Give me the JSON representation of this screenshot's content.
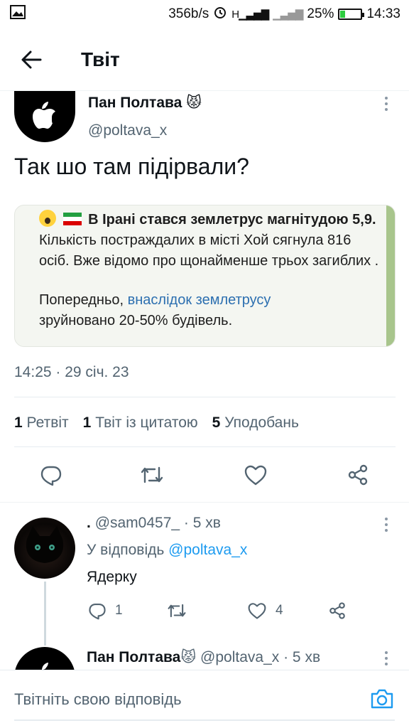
{
  "status_bar": {
    "speed": "356b/s",
    "network": "H",
    "battery": "25%",
    "battery_level": 0.25,
    "time": "14:33"
  },
  "header": {
    "title": "Твіт"
  },
  "tweet": {
    "author_name": "Пан Полтава",
    "author_handle": "@poltava_x",
    "text": "Так шо там підірвали?",
    "embed": {
      "bold_text": "В Ірані стався землетрус магнітудою 5,9.",
      "body_text": " Кількість постраждалих в місті Хой сягнула 816 осіб. Вже відомо про щонайменше трьох загиблих .",
      "para2_prefix": "Попередньо, ",
      "para2_link": "внаслідок землетрусу",
      "para2_suffix": "зруйновано 20-50% будівель."
    },
    "timestamp": "14:25 · 29 січ. 23",
    "stats": {
      "retweets_count": "1",
      "retweets_label": "Ретвіт",
      "quotes_count": "1",
      "quotes_label": "Твіт із цитатою",
      "likes_count": "5",
      "likes_label": "Уподобань"
    }
  },
  "reply": {
    "name": ".",
    "handle": "@sam0457_",
    "time": "· 5 хв",
    "reply_to_prefix": "У відповідь ",
    "reply_to_handle": "@poltava_x",
    "text": "Ядерку",
    "reply_count": "1",
    "like_count": "4"
  },
  "next_tweet": {
    "name": "Пан Полтава",
    "handle": "@poltava_x",
    "time": "· 5 хв"
  },
  "composer": {
    "placeholder": "Твітніть свою відповідь"
  },
  "colors": {
    "accent": "#1d9bf0",
    "text": "#0f1419",
    "muted": "#536471"
  }
}
